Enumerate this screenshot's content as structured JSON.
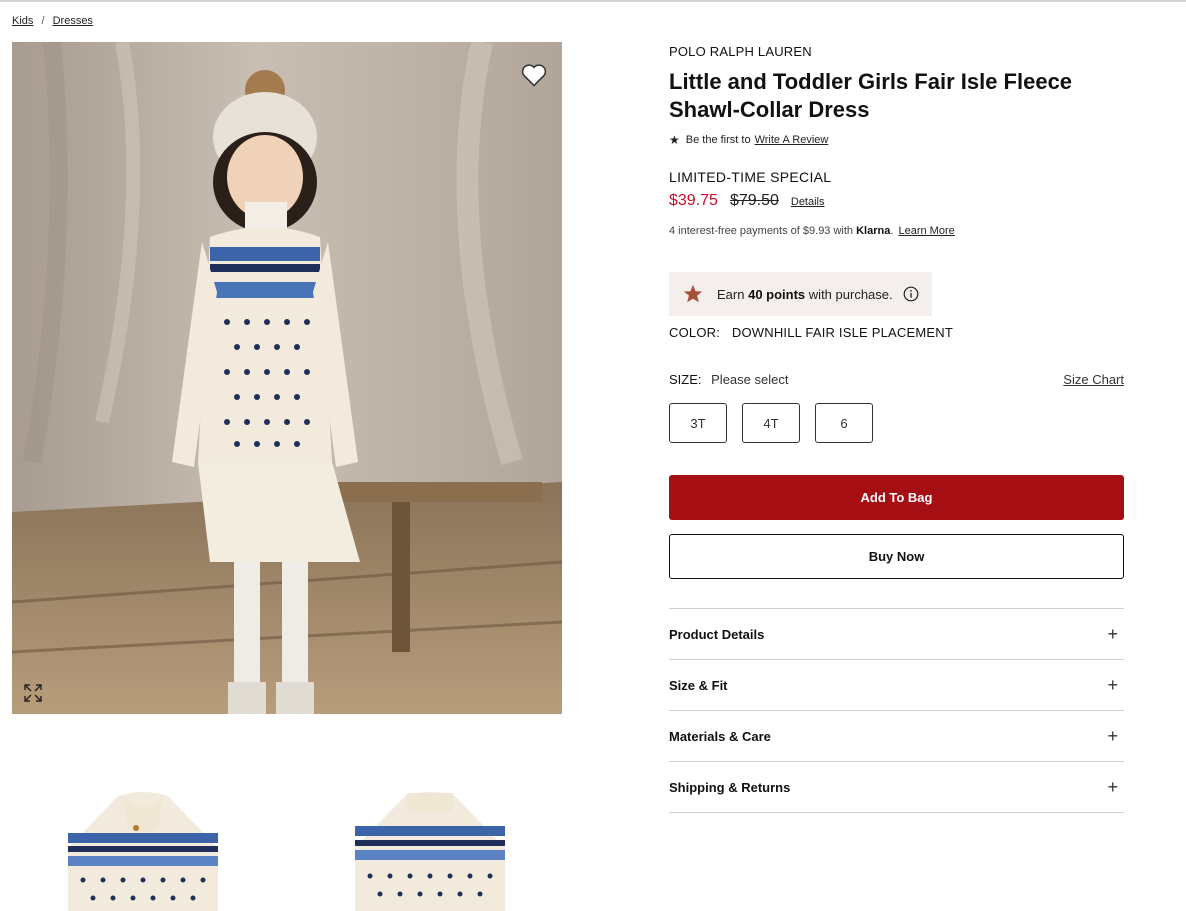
{
  "breadcrumb": [
    {
      "label": "Kids"
    },
    {
      "label": "Dresses"
    }
  ],
  "breadcrumb_separator": "/",
  "product": {
    "brand": "POLO RALPH LAUREN",
    "title": "Little and Toddler Girls Fair Isle Fleece Shawl-Collar Dress",
    "review_prefix": "Be the first to",
    "review_link": "Write A Review",
    "promo_label": "LIMITED-TIME SPECIAL",
    "sale_price": "$39.75",
    "original_price": "$79.50",
    "details_link": "Details",
    "klarna_text": "4 interest-free payments of $9.93 with",
    "klarna_brand": "Klarna",
    "klarna_link": "Learn More",
    "points_prefix": "Earn",
    "points_value": "40 points",
    "points_suffix": "with purchase.",
    "color_label": "COLOR:",
    "color_value": "DOWNHILL FAIR ISLE PLACEMENT",
    "size_label": "SIZE:",
    "size_value": "Please select",
    "size_chart_link": "Size Chart",
    "sizes": [
      "3T",
      "4T",
      "6"
    ],
    "add_to_bag": "Add To Bag",
    "buy_now": "Buy Now"
  },
  "accordion": [
    {
      "label": "Product Details",
      "icon": "plus-icon"
    },
    {
      "label": "Size & Fit",
      "icon": "plus-icon"
    },
    {
      "label": "Materials & Care",
      "icon": "plus-icon"
    },
    {
      "label": "Shipping & Returns",
      "icon": "plus-icon"
    }
  ],
  "icons": {
    "wishlist": "heart-icon",
    "zoom": "expand-icon",
    "rating": "star-icon",
    "points": "star-icon",
    "points_info": "info-icon"
  },
  "colors": {
    "sale_price": "#c8102e",
    "add_to_bag_bg": "#a50f14",
    "points_bg": "#f4efec",
    "points_star": "#a6503a"
  }
}
